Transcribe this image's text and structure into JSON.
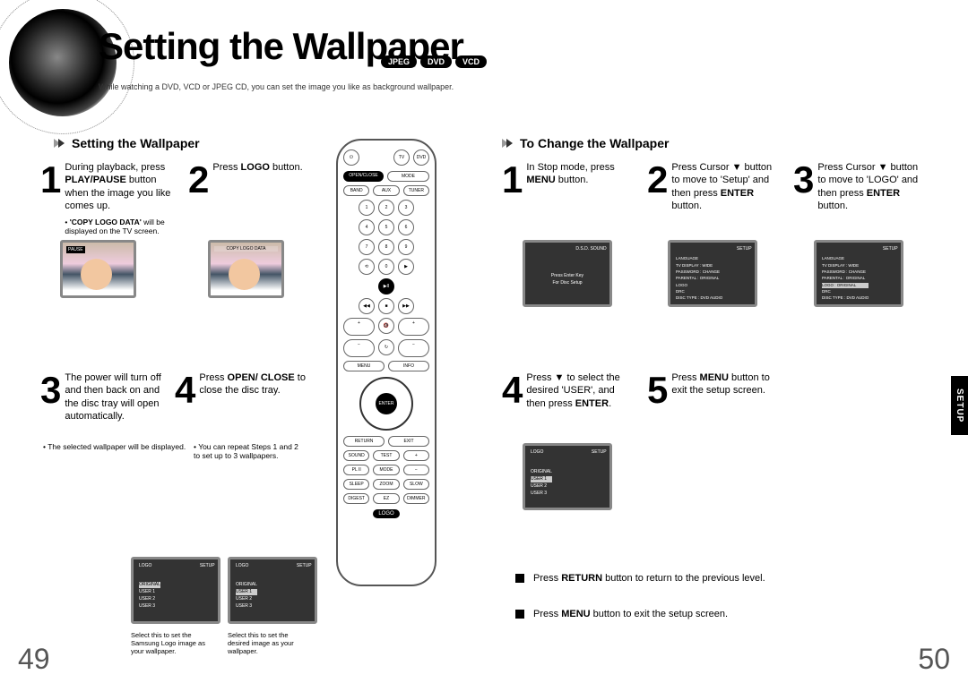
{
  "title": "Setting the Wallpaper",
  "pills": [
    "JPEG",
    "DVD",
    "VCD"
  ],
  "intro": "While watching a DVD, VCD or JPEG CD, you can set the image you like as background wallpaper.",
  "section1_title": "Setting the Wallpaper",
  "section2_title": "To Change the Wallpaper",
  "left_steps": {
    "s1": {
      "num": "1",
      "text_prefix": "During playback, press ",
      "bold1": "PLAY/PAUSE",
      "text_mid": " button when the image you like comes up.",
      "note_prefix": "'COPY LOGO DATA'",
      "note_suffix": " will be displayed on the TV screen."
    },
    "s2": {
      "num": "2",
      "text_prefix": "Press ",
      "bold1": "LOGO",
      "text_suffix": " button."
    },
    "s3": {
      "num": "3",
      "text": "The power will turn off and then back on and the disc tray will open automatically.",
      "note": "The selected wallpaper will be displayed."
    },
    "s4": {
      "num": "4",
      "text_prefix": "Press ",
      "bold1": "OPEN/ CLOSE",
      "text_suffix": " to close the disc tray.",
      "note": "You can repeat Steps 1 and 2 to set up to 3 wallpapers."
    }
  },
  "right_steps": {
    "s1": {
      "num": "1",
      "text_prefix": "In Stop mode, press ",
      "bold1": "MENU",
      "text_suffix": " button."
    },
    "s2": {
      "num": "2",
      "text_prefix": "Press Cursor ▼ button to move to 'Setup' and then press ",
      "bold1": "ENTER",
      "text_suffix": " button."
    },
    "s3": {
      "num": "3",
      "text_prefix": "Press Cursor ▼ button to move to 'LOGO' and then press ",
      "bold1": "ENTER",
      "text_suffix": " button."
    },
    "s4": {
      "num": "4",
      "text_prefix": "Press ▼ to select the desired 'USER', and then press ",
      "bold1": "ENTER",
      "text_suffix": "."
    },
    "s5": {
      "num": "5",
      "text_prefix": "Press ",
      "bold1": "MENU",
      "text_suffix": " button to exit the setup screen."
    }
  },
  "infobox": {
    "line1_prefix": "Press ",
    "line1_bold": "RETURN",
    "line1_suffix": " button to return to the previous level.",
    "line2_prefix": "Press ",
    "line2_bold": "MENU",
    "line2_suffix": " button to exit the setup screen."
  },
  "captions": {
    "c1": "Select this to set the Samsung Logo image as your wallpaper.",
    "c2": "Select this to set the desired image as your wallpaper."
  },
  "tv_menus": {
    "main": {
      "title": "D.S.D. SOUND",
      "items": [
        "Press Enter Key",
        "For Disc Setup"
      ]
    },
    "setup": {
      "title": "SETUP",
      "items": [
        "LANGUAGE",
        "TV DISPLAY",
        "PASSWORD",
        "PARENTAL",
        "LOGO",
        "DRC",
        "DISC TYPE"
      ],
      "values": [
        "",
        "WIDE",
        "CHANGE",
        "ORIGINAL",
        "",
        "",
        "DVD AUDIO"
      ],
      "highlight": 4
    },
    "setup2": {
      "title": "SETUP",
      "items": [
        "LANGUAGE",
        "TV DISPLAY",
        "PASSWORD",
        "PARENTAL",
        "LOGO",
        "DRC",
        "DISC TYPE"
      ],
      "values": [
        "",
        "WIDE",
        "CHANGE",
        "ORIGINAL",
        "ORIGINAL",
        "",
        "DVD AUDIO"
      ],
      "highlight": 4
    },
    "logo1": {
      "title": "SETUP",
      "items": [
        "ORIGINAL",
        "USER 1",
        "USER 2",
        "USER 3"
      ],
      "highlight": 0
    },
    "logo2": {
      "title": "SETUP",
      "items": [
        "ORIGINAL",
        "USER 1",
        "USER 2",
        "USER 3"
      ],
      "highlight": 1
    },
    "user": {
      "title": "LOGO",
      "items": [
        "ORIGINAL",
        "USER 1",
        "USER 2",
        "USER 3"
      ],
      "highlight": 1
    }
  },
  "baby_banner": "COPY LOGO DATA",
  "pause_label": "PAUSE",
  "remote": {
    "openclose": "OPEN/CLOSE",
    "enter": "ENTER",
    "logo": "LOGO"
  },
  "page_left": "49",
  "page_right": "50",
  "side_tab": "SETUP"
}
